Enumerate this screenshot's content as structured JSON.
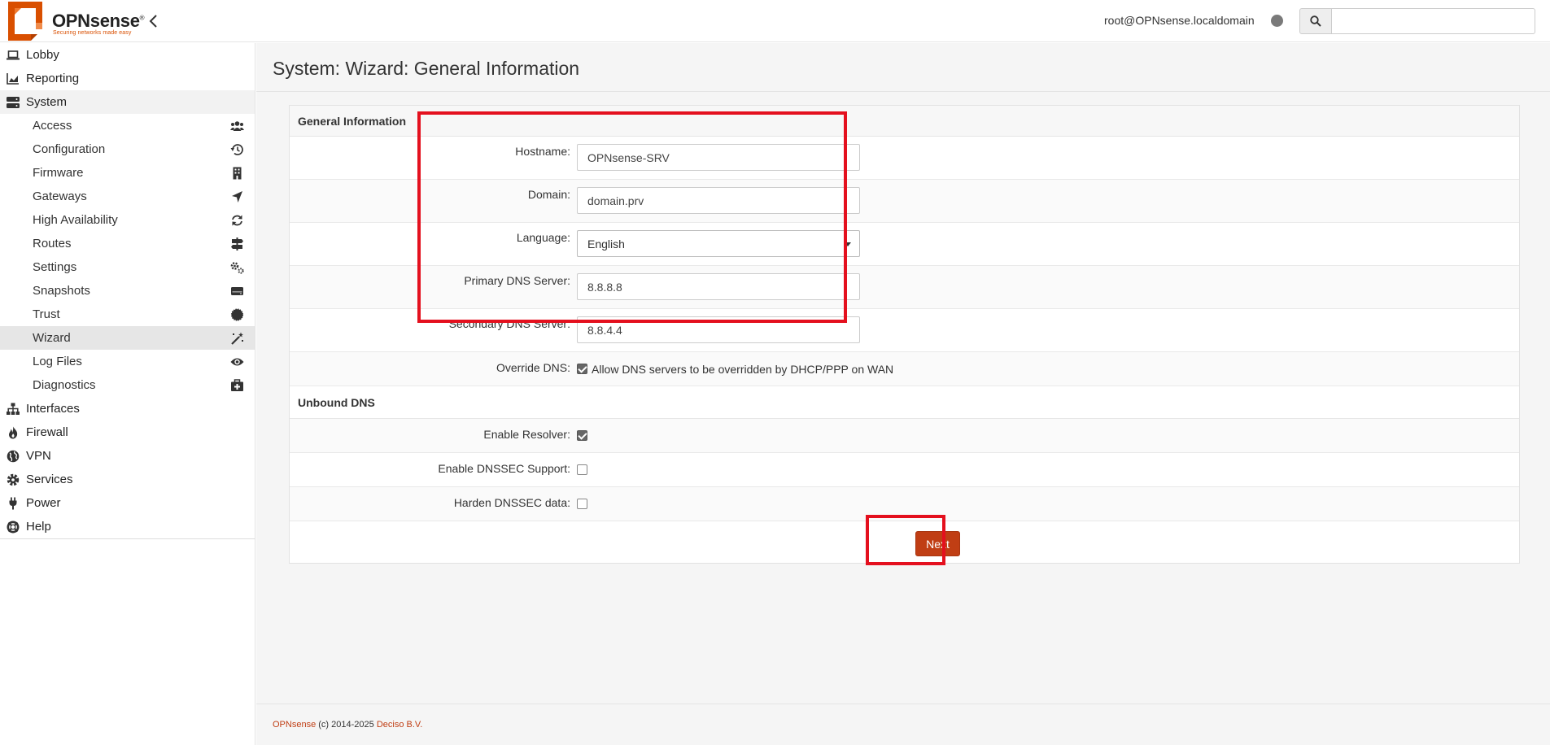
{
  "brand": {
    "name": "OPNsense",
    "reg_mark": "®",
    "tagline": "Securing networks made easy",
    "color": "#d94f00"
  },
  "header": {
    "user": "root@OPNsense.localdomain",
    "search_placeholder": ""
  },
  "sidebar": {
    "items": [
      {
        "label": "Lobby",
        "icon": "laptop-icon"
      },
      {
        "label": "Reporting",
        "icon": "chart-area-icon"
      },
      {
        "label": "System",
        "icon": "server-icon"
      },
      {
        "label": "Interfaces",
        "icon": "sitemap-icon"
      },
      {
        "label": "Firewall",
        "icon": "fire-icon"
      },
      {
        "label": "VPN",
        "icon": "globe-icon"
      },
      {
        "label": "Services",
        "icon": "cog-icon"
      },
      {
        "label": "Power",
        "icon": "plug-icon"
      },
      {
        "label": "Help",
        "icon": "life-ring-icon"
      }
    ],
    "system_sub": [
      {
        "label": "Access",
        "icon": "users-icon"
      },
      {
        "label": "Configuration",
        "icon": "history-icon"
      },
      {
        "label": "Firmware",
        "icon": "building-icon"
      },
      {
        "label": "Gateways",
        "icon": "location-arrow-icon"
      },
      {
        "label": "High Availability",
        "icon": "refresh-icon"
      },
      {
        "label": "Routes",
        "icon": "map-signs-icon"
      },
      {
        "label": "Settings",
        "icon": "cogs-icon"
      },
      {
        "label": "Snapshots",
        "icon": "hdd-icon"
      },
      {
        "label": "Trust",
        "icon": "certificate-icon"
      },
      {
        "label": "Wizard",
        "icon": "magic-icon",
        "active": true
      },
      {
        "label": "Log Files",
        "icon": "eye-icon"
      },
      {
        "label": "Diagnostics",
        "icon": "medkit-icon"
      }
    ]
  },
  "page": {
    "title": "System: Wizard: General Information"
  },
  "form": {
    "section_general": "General Information",
    "hostname_label": "Hostname:",
    "hostname_value": "OPNsense-SRV",
    "domain_label": "Domain:",
    "domain_value": "domain.prv",
    "language_label": "Language:",
    "language_value": "English",
    "primary_dns_label": "Primary DNS Server:",
    "primary_dns_value": "8.8.8.8",
    "secondary_dns_label": "Secondary DNS Server:",
    "secondary_dns_value": "8.8.4.4",
    "override_dns_label": "Override DNS:",
    "override_dns_desc": "Allow DNS servers to be overridden by DHCP/PPP on WAN",
    "override_dns_checked": true,
    "section_unbound": "Unbound DNS",
    "enable_resolver_label": "Enable Resolver:",
    "enable_resolver_checked": true,
    "dnssec_label": "Enable DNSSEC Support:",
    "dnssec_checked": false,
    "harden_label": "Harden DNSSEC data:",
    "harden_checked": false,
    "next_label": "Next"
  },
  "footer": {
    "brand": "OPNsense",
    "copyright": "(c) 2014-2025",
    "company": "Deciso B.V."
  },
  "colors": {
    "accent": "#c03e14",
    "highlight": "#e4101e"
  }
}
